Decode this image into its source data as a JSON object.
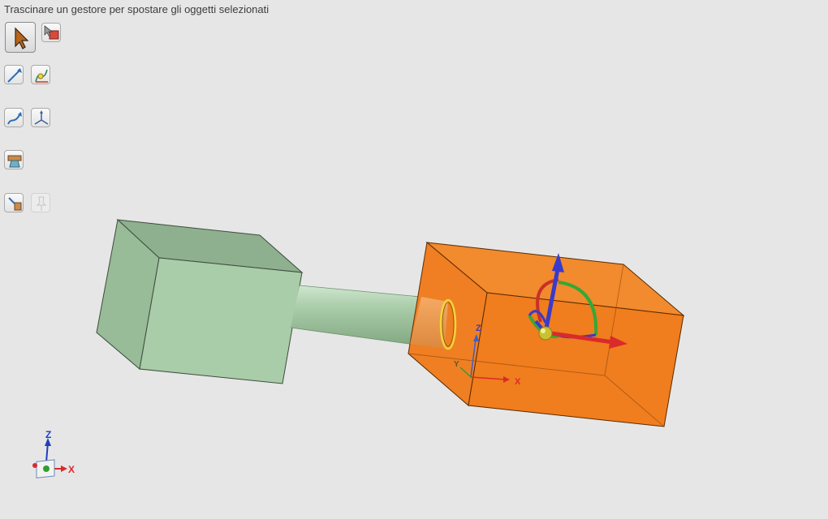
{
  "hint": {
    "text": "Trascinare un gestore per spostare gli oggetti selezionati"
  },
  "toolbar": {
    "tools": [
      {
        "name": "select-tool",
        "icon": "arrow-pointer-icon"
      },
      {
        "name": "select-move-tool",
        "icon": "cursor-box-icon"
      },
      {
        "name": "line-move-tool",
        "icon": "linear-move-icon"
      },
      {
        "name": "point-move-tool",
        "icon": "point-move-icon"
      },
      {
        "name": "curve-move-tool",
        "icon": "curve-move-icon"
      },
      {
        "name": "triad-move-tool",
        "icon": "triad-icon"
      },
      {
        "name": "pull-tool",
        "icon": "anvil-icon"
      },
      {
        "name": "fill-tool",
        "icon": "hammer-block-icon"
      },
      {
        "name": "disabled-tool",
        "icon": "pin-icon"
      }
    ]
  },
  "move_handle": {
    "label_x": "X",
    "label_y": "Y",
    "label_z": "Z"
  },
  "view_triad": {
    "label_x": "X",
    "label_z": "Z"
  },
  "colors": {
    "green_body": "#a9cca9",
    "orange_body": "#f07d1e",
    "axis_x": "#d92b2b",
    "axis_y": "#2f9f2f",
    "axis_z": "#3a3aca",
    "background": "#e6e6e6"
  }
}
